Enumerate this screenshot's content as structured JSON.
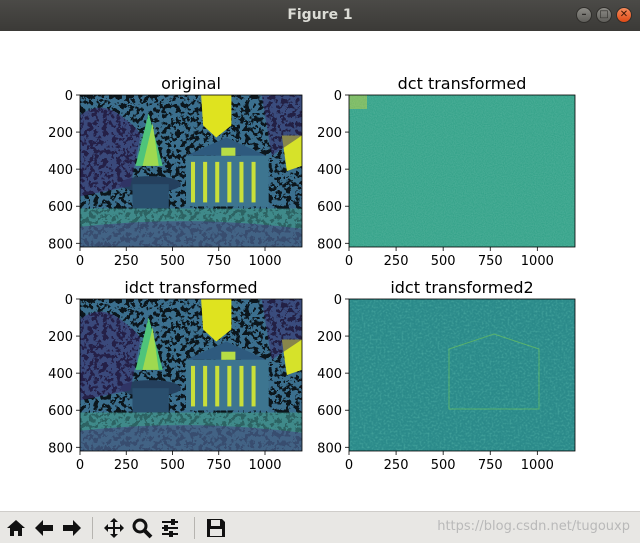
{
  "window": {
    "title": "Figure 1"
  },
  "plots": [
    {
      "title": "original",
      "image": "original"
    },
    {
      "title": "dct transformed",
      "image": "dct"
    },
    {
      "title": "idct transformed",
      "image": "original"
    },
    {
      "title": "idct transformed2",
      "image": "idct2"
    }
  ],
  "axes": {
    "x_ticks": [
      "0",
      "250",
      "500",
      "750",
      "1000"
    ],
    "y_ticks": [
      "0",
      "200",
      "400",
      "600",
      "800"
    ]
  },
  "chart_data": [
    {
      "type": "heatmap",
      "title": "original",
      "xlim": [
        0,
        1200
      ],
      "ylim": [
        820,
        0
      ],
      "x_ticks": [
        0,
        250,
        500,
        750,
        1000
      ],
      "y_ticks": [
        0,
        200,
        400,
        600,
        800
      ]
    },
    {
      "type": "heatmap",
      "title": "dct transformed",
      "xlim": [
        0,
        1200
      ],
      "ylim": [
        820,
        0
      ],
      "x_ticks": [
        0,
        250,
        500,
        750,
        1000
      ],
      "y_ticks": [
        0,
        200,
        400,
        600,
        800
      ]
    },
    {
      "type": "heatmap",
      "title": "idct transformed",
      "xlim": [
        0,
        1200
      ],
      "ylim": [
        820,
        0
      ],
      "x_ticks": [
        0,
        250,
        500,
        750,
        1000
      ],
      "y_ticks": [
        0,
        200,
        400,
        600,
        800
      ]
    },
    {
      "type": "heatmap",
      "title": "idct transformed2",
      "xlim": [
        0,
        1200
      ],
      "ylim": [
        820,
        0
      ],
      "x_ticks": [
        0,
        250,
        500,
        750,
        1000
      ],
      "y_ticks": [
        0,
        200,
        400,
        600,
        800
      ]
    }
  ],
  "colormap": {
    "low": "#440154",
    "mid_low": "#31688e",
    "mid": "#35b779",
    "high": "#fde725"
  },
  "toolbar": {
    "buttons": [
      "home-icon",
      "back-arrow-icon",
      "forward-arrow-icon",
      "pan-icon",
      "zoom-icon",
      "subplots-icon",
      "save-icon"
    ]
  },
  "watermark": "https://blog.csdn.net/tugouxp"
}
